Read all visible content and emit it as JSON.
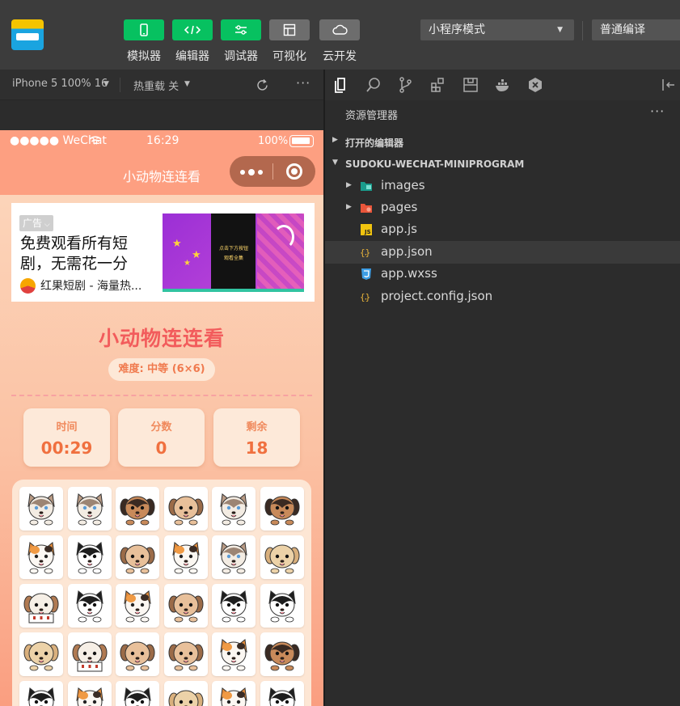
{
  "toolbar": {
    "buttons": [
      {
        "label": "模拟器",
        "icon": "phone-icon",
        "color": "#07c160"
      },
      {
        "label": "编辑器",
        "icon": "code-icon",
        "color": "#07c160"
      },
      {
        "label": "调试器",
        "icon": "sliders-icon",
        "color": "#07c160"
      },
      {
        "label": "可视化",
        "icon": "layout-icon",
        "color": "#6d6d6d"
      },
      {
        "label": "云开发",
        "icon": "cloud-icon",
        "color": "#6d6d6d"
      }
    ],
    "mode_select": "小程序模式",
    "compile_select": "普通编译"
  },
  "simulator_bar": {
    "device": "iPhone 5 100% 16",
    "hot_reload": "热重载 关"
  },
  "phone": {
    "status": {
      "carrier": "●●●●● WeChat",
      "time": "16:29",
      "battery": "100%"
    },
    "nav_title": "小动物连连看",
    "ad": {
      "tag": "广告",
      "title": "免费观看所有短剧，无需花一分",
      "app_name": "红果短剧 - 海量热...",
      "image_caption_1": "点击下方按钮",
      "image_caption_2": "观看全集"
    },
    "game": {
      "title": "小动物连连看",
      "difficulty": "难度: 中等 (6×6)",
      "stats": [
        {
          "label": "时间",
          "value": "00:29"
        },
        {
          "label": "分数",
          "value": "0"
        },
        {
          "label": "剩余",
          "value": "18"
        }
      ],
      "board_rows": [
        [
          "cat-siamese",
          "cat-siamese",
          "dog-rottweiler",
          "dog-beagle",
          "cat-siamese",
          "dog-rottweiler"
        ],
        [
          "cat-calico",
          "dog-husky",
          "dog-beagle",
          "cat-calico",
          "cat-siamese",
          "hamster"
        ],
        [
          "dog-beagle-basket",
          "dog-husky",
          "cat-calico",
          "dog-beagle",
          "dog-husky",
          "dog-husky"
        ],
        [
          "hamster",
          "dog-beagle-basket",
          "dog-beagle",
          "dog-beagle",
          "cat-calico",
          "dog-rottweiler"
        ],
        [
          "dog-husky",
          "cat-calico",
          "dog-husky",
          "hamster",
          "cat-calico",
          "dog-husky"
        ]
      ]
    }
  },
  "explorer": {
    "title": "资源管理器",
    "more": "···",
    "sections": [
      "打开的编辑器",
      "SUDOKU-WECHAT-MINIPROGRAM"
    ],
    "files": [
      {
        "name": "images",
        "type": "folder",
        "icon": "images-folder-icon"
      },
      {
        "name": "pages",
        "type": "folder",
        "icon": "pages-folder-icon"
      },
      {
        "name": "app.js",
        "type": "js",
        "icon": "js-file-icon"
      },
      {
        "name": "app.json",
        "type": "json",
        "icon": "json-file-icon",
        "selected": true
      },
      {
        "name": "app.wxss",
        "type": "css",
        "icon": "css-file-icon"
      },
      {
        "name": "project.config.json",
        "type": "json",
        "icon": "json-file-icon"
      }
    ]
  }
}
